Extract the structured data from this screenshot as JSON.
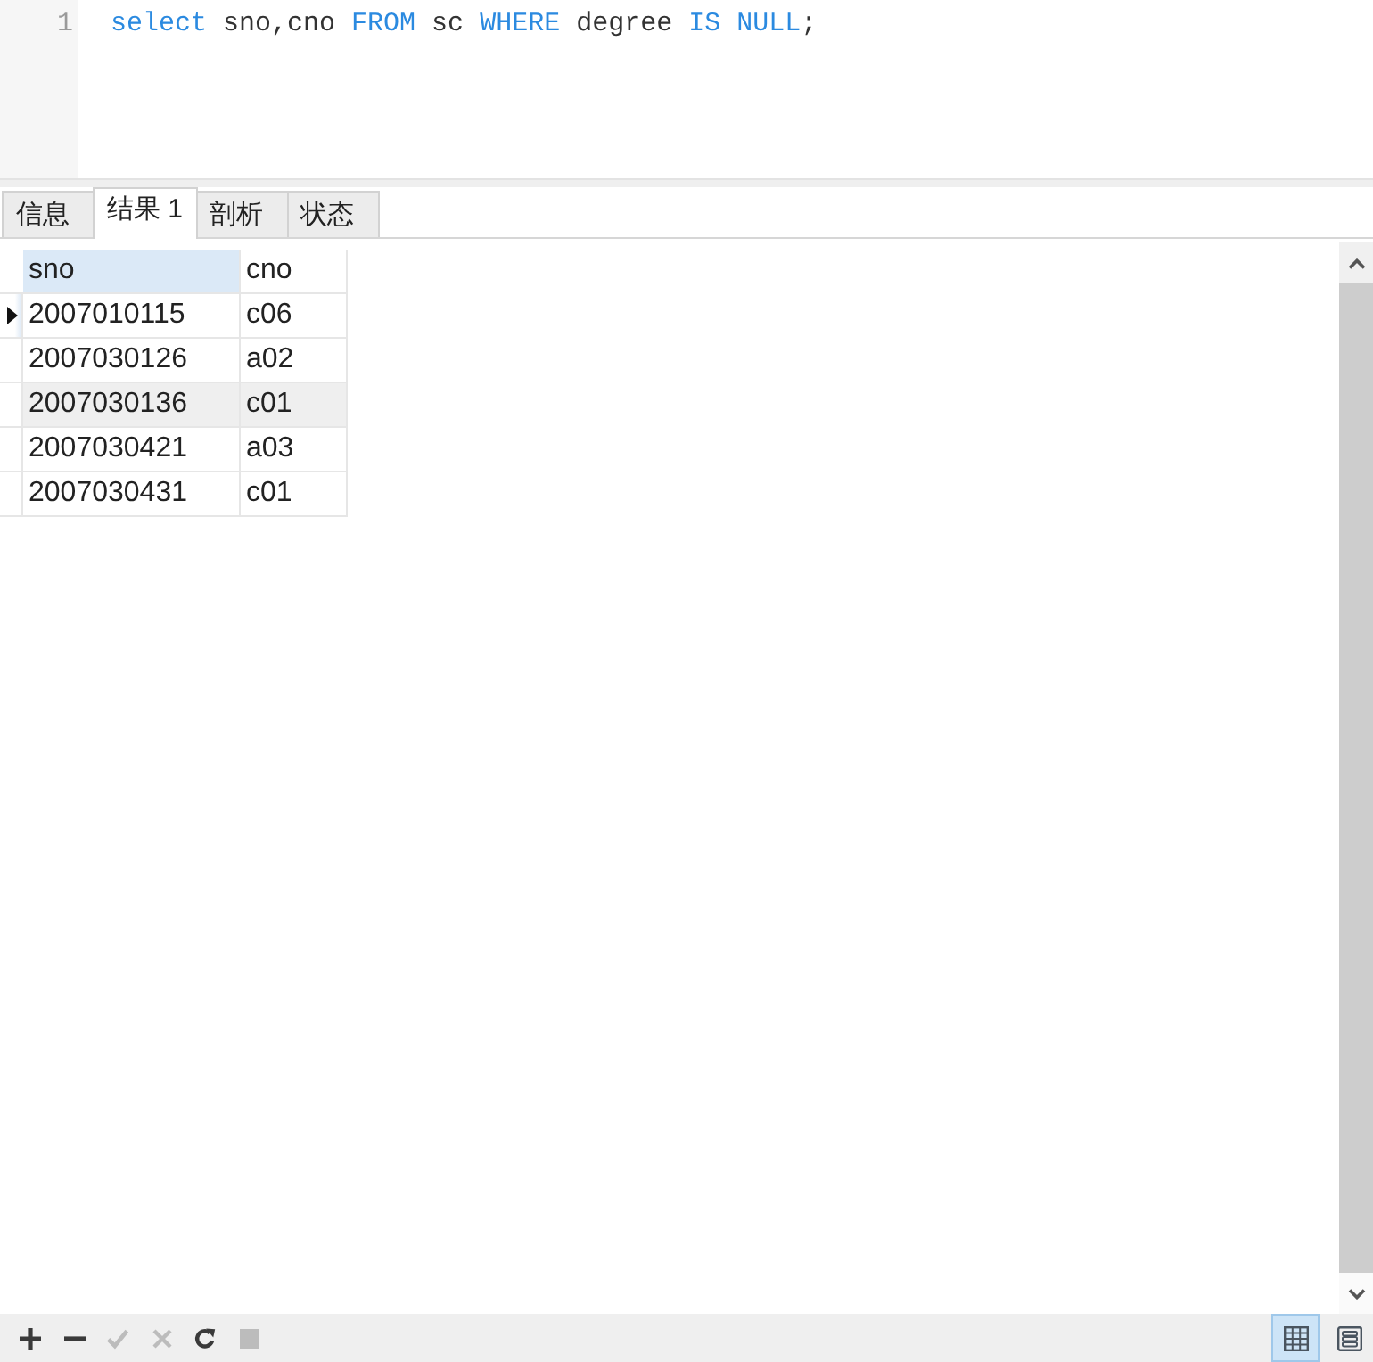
{
  "editor": {
    "lines": [
      {
        "number": "1",
        "tokens": [
          {
            "text": "select",
            "kind": "keyword"
          },
          {
            "text": " sno,cno ",
            "kind": "plain"
          },
          {
            "text": "FROM",
            "kind": "keyword"
          },
          {
            "text": " sc ",
            "kind": "plain"
          },
          {
            "text": "WHERE",
            "kind": "keyword"
          },
          {
            "text": " degree ",
            "kind": "plain"
          },
          {
            "text": "IS NULL",
            "kind": "keyword"
          },
          {
            "text": ";",
            "kind": "plain"
          }
        ]
      }
    ]
  },
  "tabs": [
    {
      "label": "信息",
      "selected": false
    },
    {
      "label": "结果 1",
      "selected": true
    },
    {
      "label": "剖析",
      "selected": false
    },
    {
      "label": "状态",
      "selected": false
    }
  ],
  "table": {
    "columns": [
      {
        "label": "sno",
        "selected": true
      },
      {
        "label": "cno",
        "selected": false
      }
    ],
    "rows": [
      {
        "cells": [
          "2007010115",
          "c06"
        ],
        "selected": true,
        "hovered": false
      },
      {
        "cells": [
          "2007030126",
          "a02"
        ],
        "selected": false,
        "hovered": false
      },
      {
        "cells": [
          "2007030136",
          "c01"
        ],
        "selected": false,
        "hovered": true
      },
      {
        "cells": [
          "2007030421",
          "a03"
        ],
        "selected": false,
        "hovered": false
      },
      {
        "cells": [
          "2007030431",
          "c01"
        ],
        "selected": false,
        "hovered": false
      }
    ]
  },
  "toolbar": [
    {
      "kind": "add",
      "disabled": false
    },
    {
      "kind": "delete",
      "disabled": false
    },
    {
      "kind": "apply",
      "disabled": true
    },
    {
      "kind": "discard",
      "disabled": true
    },
    {
      "kind": "refresh",
      "disabled": false
    },
    {
      "kind": "stop",
      "disabled": true
    }
  ],
  "view_buttons": [
    {
      "kind": "grid",
      "selected": true
    },
    {
      "kind": "form",
      "selected": false
    }
  ]
}
